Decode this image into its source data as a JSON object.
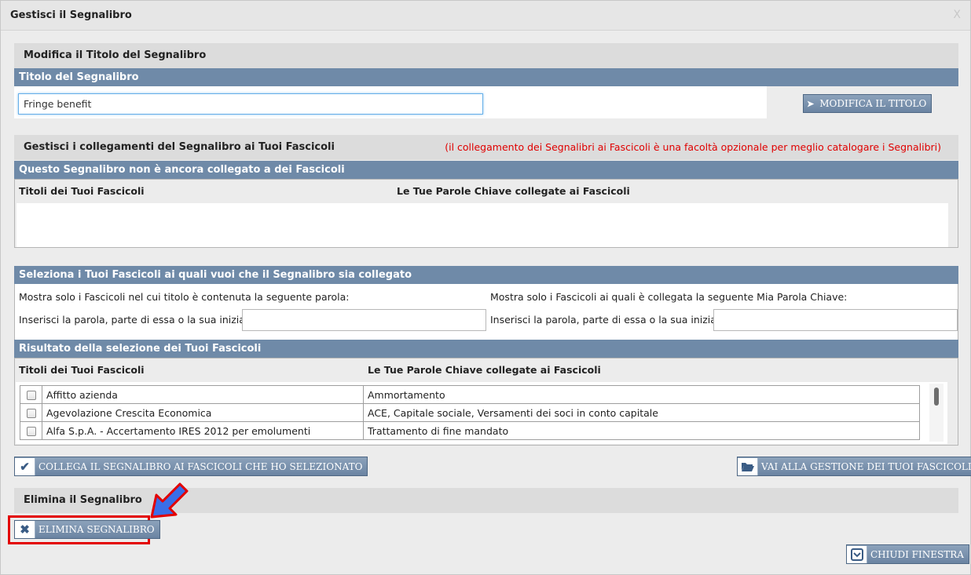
{
  "dialog": {
    "title": "Gestisci il Segnalibro",
    "close_label": "X"
  },
  "title_section": {
    "heading": "Modifica il Titolo del Segnalibro",
    "bar_label": "Titolo del Segnalibro",
    "title_value": "Fringe benefit",
    "modify_button": "MODIFICA IL TITOLO"
  },
  "links_section": {
    "heading": "Gestisci i collegamenti del Segnalibro ai Tuoi Fascicoli",
    "note": "(il collegamento dei Segnalibri ai Fascicoli è una facoltà opzionale per meglio catalogare i Segnalibri)",
    "bar_label": "Questo Segnalibro non è ancora collegato a dei Fascicoli",
    "col_titles": "Titoli dei Tuoi Fascicoli",
    "col_keywords": "Le Tue Parole Chiave collegate ai Fascicoli"
  },
  "select_section": {
    "bar_label": "Seleziona i Tuoi Fascicoli ai quali vuoi che il Segnalibro sia collegato",
    "filter_title_label": "Mostra solo i Fascicoli nel cui titolo è contenuta la seguente parola:",
    "filter_keyword_label": "Mostra solo i Fascicoli ai quali è collegata la seguente Mia Parola Chiave:",
    "input_label_left": "Inserisci la parola, parte di essa o la sua iniziale",
    "input_label_right": "Inserisci la parola, parte di essa o la sua iniziale",
    "input_left_value": "",
    "input_right_value": ""
  },
  "results_section": {
    "bar_label": "Risultato della selezione dei Tuoi Fascicoli",
    "col_titles": "Titoli dei Tuoi Fascicoli",
    "col_keywords": "Le Tue Parole Chiave collegate ai Fascicoli",
    "rows": [
      {
        "title": "Affitto azienda",
        "keywords": "Ammortamento"
      },
      {
        "title": "Agevolazione Crescita Economica",
        "keywords": "ACE, Capitale sociale, Versamenti dei soci in conto capitale"
      },
      {
        "title": "Alfa S.p.A. - Accertamento IRES 2012 per emolumenti",
        "keywords": "Trattamento di fine mandato"
      }
    ]
  },
  "actions": {
    "link_button": "COLLEGA IL SEGNALIBRO AI FASCICOLI CHE HO SELEZIONATO",
    "manage_button": "VAI ALLA GESTIONE DEI TUOI FASCICOLI"
  },
  "delete_section": {
    "heading": "Elimina il Segnalibro",
    "delete_button": "ELIMINA SEGNALIBRO"
  },
  "footer": {
    "close_button": "CHIUDI FINESTRA"
  },
  "colors": {
    "bar": "#6f8aa8",
    "highlight": "#e30000",
    "arrow": "#3a6ee8",
    "note": "#e00000"
  }
}
